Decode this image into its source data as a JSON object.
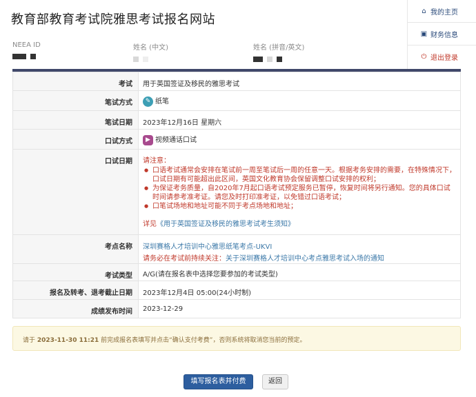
{
  "header": {
    "title": "教育部教育考试院雅思考试报名网站",
    "neea_id_label": "NEEA ID",
    "name_cn_label": "姓名 (中文)",
    "name_en_label": "姓名 (拼音/英文)"
  },
  "nav": {
    "home": "我的主页",
    "finance": "财务信息",
    "logout": "退出登录"
  },
  "details": {
    "exam_label": "考试",
    "exam_value": "用于英国签证及移民的雅思考试",
    "written_mode_label": "笔试方式",
    "written_mode_value": "纸笔",
    "written_date_label": "笔试日期",
    "written_date_value": "2023年12月16日 星期六",
    "speaking_mode_label": "口试方式",
    "speaking_mode_value": "视频通话口试",
    "speaking_date_label": "口试日期",
    "speaking_date_note_title": "请注意：",
    "speaking_date_notes": [
      "口语考试通常会安排在笔试前一周至笔试后一周的任意一天。根据考务安排的需要，在特殊情况下，口试日期有可能超出此区间，英国文化教育协会保留调整口试安排的权利；",
      "为保证考务质量，自2020年7月起口语考试预定服务已暂停，恢复时间将另行通知。您的具体口试时间请参考准考证。请您及时打印准考证，以免错过口语考试；",
      "口笔试场地和地址可能不同于考点场地和地址；"
    ],
    "speaking_date_see": "详见",
    "speaking_date_link": "《用于英国签证及移民的雅思考试考生须知》",
    "center_label": "考点名称",
    "center_value": "深圳赛格人才培训中心雅思纸笔考点-UKVI",
    "center_note": "请务必在考试前持续关注：",
    "center_note_link": "关于深圳赛格人才培训中心考点雅思考试入场的通知",
    "type_label": "考试类型",
    "type_value": "A/G(请在报名表中选择您要参加的考试类型)",
    "deadline_label": "报名及转考、退考截止日期",
    "deadline_value": "2023年12月4日 05:00(24小时制)",
    "result_label": "成绩发布时间",
    "result_value": "2023-12-29"
  },
  "notice": {
    "prefix": "请于",
    "deadline": "2023-11-30 11:21",
    "suffix": "前完成报名表填写并点击“确认支付考费”，否则系统将取消您当前的预定。"
  },
  "buttons": {
    "fill_pay": "填写报名表并付费",
    "back": "返回"
  },
  "colors": {
    "accent": "#2d5e9f",
    "warning": "#c0392b",
    "topbar": "#40486a"
  }
}
